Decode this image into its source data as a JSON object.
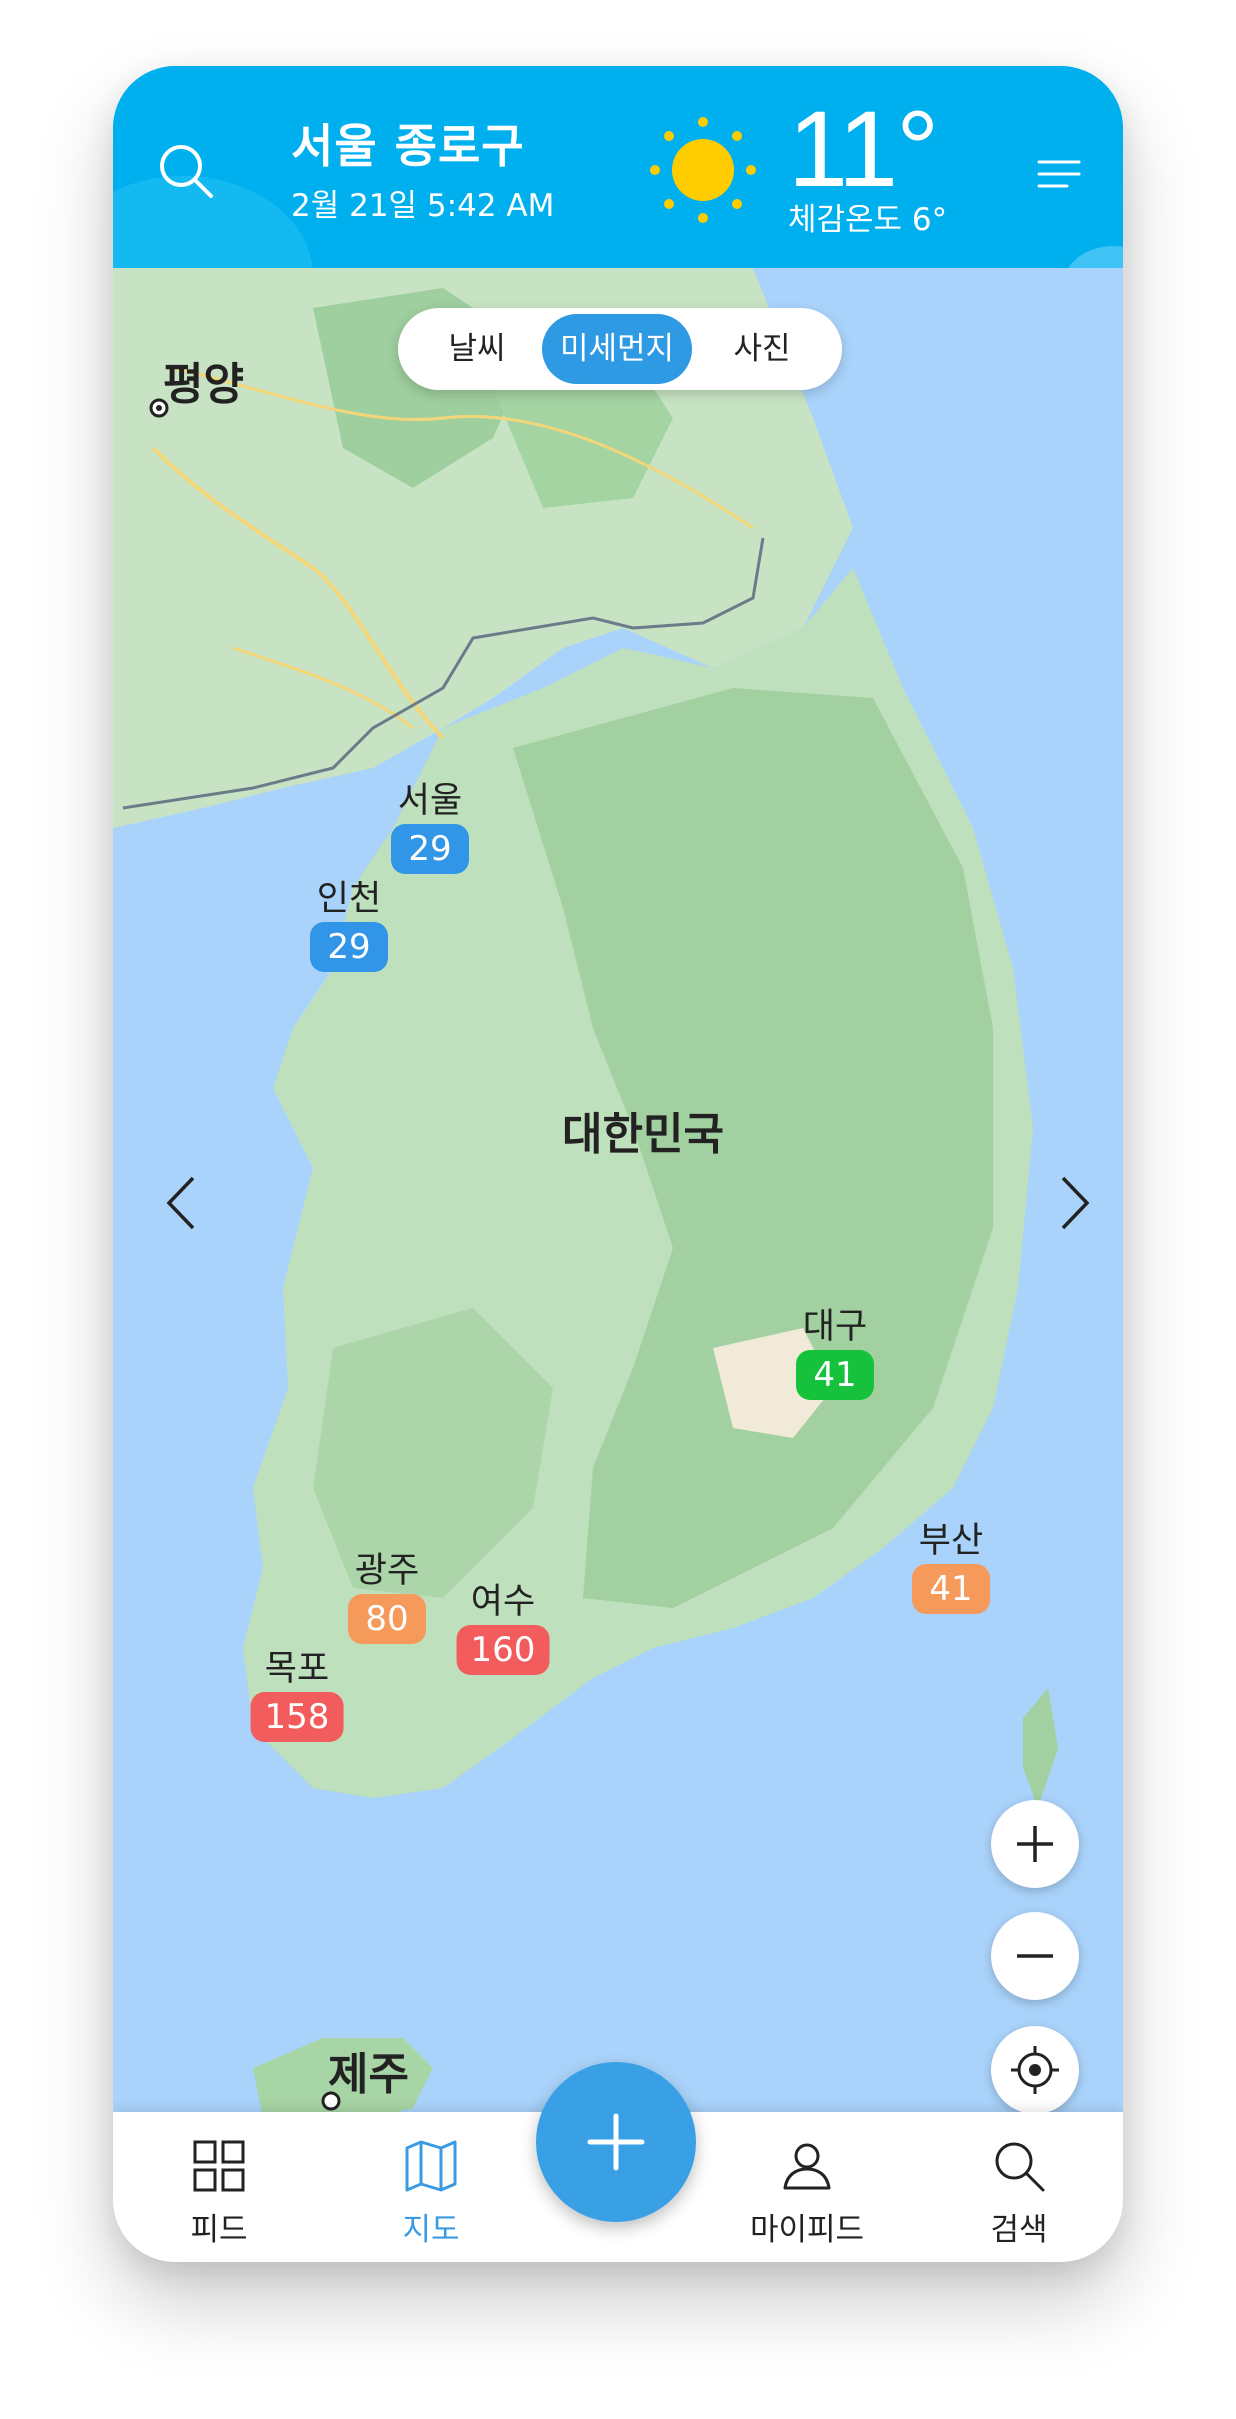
{
  "header": {
    "location": "서울 종로구",
    "datetime": "2월 21일 5:42 AM",
    "temperature": "11°",
    "feels_like": "체감온도 6°",
    "weather_icon": "sun-icon",
    "search_icon": "search-icon",
    "menu_icon": "menu-icon"
  },
  "map": {
    "tabs": [
      {
        "label": "날씨",
        "active": false
      },
      {
        "label": "미세먼지",
        "active": true
      },
      {
        "label": "사진",
        "active": false
      }
    ],
    "place_labels": {
      "pyongyang": "평양",
      "country": "대한민국",
      "jeju": "제주"
    },
    "stations": [
      {
        "name": "서울",
        "value": "29",
        "level": "good"
      },
      {
        "name": "인천",
        "value": "29",
        "level": "good"
      },
      {
        "name": "대구",
        "value": "41",
        "level": "moderate"
      },
      {
        "name": "부산",
        "value": "41",
        "level": "bad"
      },
      {
        "name": "광주",
        "value": "80",
        "level": "bad"
      },
      {
        "name": "여수",
        "value": "160",
        "level": "very_bad"
      },
      {
        "name": "목포",
        "value": "158",
        "level": "very_bad"
      }
    ],
    "level_colors": {
      "good": "#3196e8",
      "moderate": "#16c23c",
      "bad": "#f59a5a",
      "very_bad": "#f25c5c"
    },
    "controls": {
      "zoom_in_icon": "plus-icon",
      "zoom_out_icon": "minus-icon",
      "locate_icon": "crosshair-icon",
      "prev_icon": "chevron-left-icon",
      "next_icon": "chevron-right-icon"
    }
  },
  "bottom_nav": {
    "items": [
      {
        "label": "피드",
        "icon": "grid-icon",
        "active": false
      },
      {
        "label": "지도",
        "icon": "map-icon",
        "active": true
      },
      {
        "label": "마이피드",
        "icon": "user-icon",
        "active": false
      },
      {
        "label": "검색",
        "icon": "search-icon",
        "active": false
      }
    ],
    "fab_icon": "plus-icon"
  },
  "colors": {
    "header_bg": "#00b0ee",
    "accent": "#3aa0e6",
    "sea": "#aad3fb"
  }
}
